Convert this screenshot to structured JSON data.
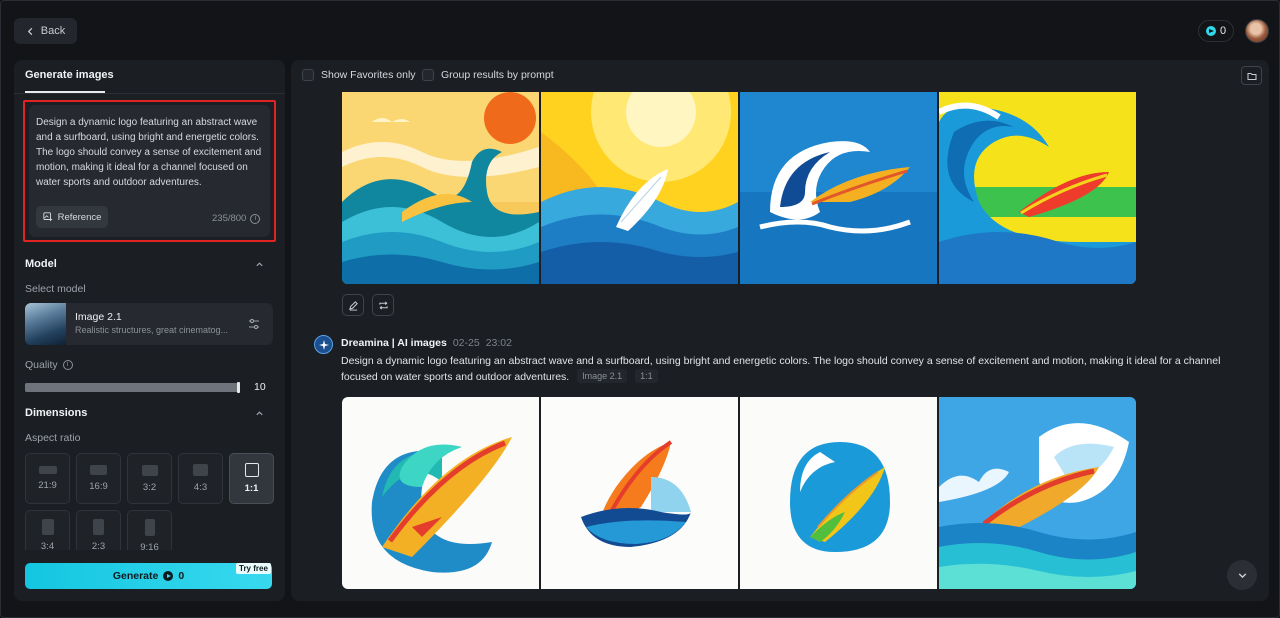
{
  "header": {
    "back_label": "Back",
    "credits_count": "0"
  },
  "left_panel": {
    "tab_label": "Generate images",
    "prompt": {
      "text": "Design a dynamic logo featuring an abstract wave and a surfboard, using bright and energetic colors. The logo should convey a sense of excitement and motion, making it ideal for a channel focused on water sports and outdoor adventures.",
      "reference_label": "Reference",
      "char_count": "235/800"
    },
    "model": {
      "section_title": "Model",
      "select_label": "Select model",
      "name": "Image 2.1",
      "description": "Realistic structures, great cinematog..."
    },
    "quality": {
      "label": "Quality",
      "value": "10",
      "level_fraction": 1.0
    },
    "dimensions": {
      "section_title": "Dimensions",
      "aspect_label": "Aspect ratio",
      "ratios": [
        "21:9",
        "16:9",
        "3:2",
        "4:3",
        "1:1",
        "3:4",
        "2:3",
        "9:16"
      ],
      "selected": "1:1"
    },
    "generate": {
      "label": "Generate",
      "cost": "0",
      "badge": "Try free"
    }
  },
  "right_panel": {
    "show_favorites_label": "Show Favorites only",
    "group_results_label": "Group results by prompt",
    "entry": {
      "author": "Dreamina | AI images",
      "date": "02-25",
      "time": "23:02",
      "prompt": "Design a dynamic logo featuring an abstract wave and a surfboard, using bright and energetic colors. The logo should convey a sense of excitement and motion, making it ideal for a channel focused on water sports and outdoor adventures.",
      "model_chip": "Image 2.1",
      "ratio_chip": "1:1"
    }
  },
  "colors": {
    "accent": "#1fcfe6",
    "highlight_border": "#e02424",
    "panel_bg": "#1b1e23",
    "page_bg": "#121418"
  }
}
